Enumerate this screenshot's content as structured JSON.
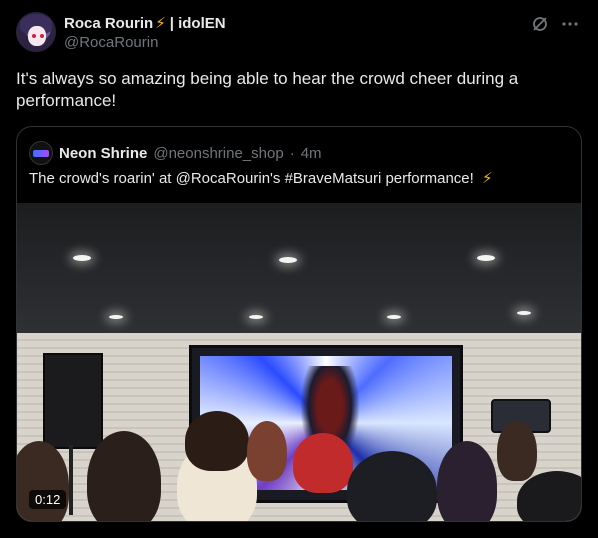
{
  "author": {
    "name": "Roca Rourin",
    "badge_icon": "lightning-icon",
    "affiliation": "| idolEN",
    "handle": "@RocaRourin"
  },
  "header_icons": [
    "grok-icon",
    "more-icon"
  ],
  "tweet": {
    "text": "It's always so amazing being able to hear the crowd cheer during a performance!"
  },
  "quote": {
    "name": "Neon Shrine",
    "handle": "@neonshrine_shop",
    "separator": "·",
    "time": "4m",
    "text": "The crowd's roarin' at @RocaRourin's #BraveMatsuri performance!",
    "text_icon": "lightning-icon",
    "media": {
      "type": "video",
      "duration": "0:12"
    }
  },
  "colors": {
    "background": "#000000",
    "text": "#e7e9ea",
    "muted": "#71767b",
    "border": "#2f3336",
    "bolt": "#f5b800"
  }
}
